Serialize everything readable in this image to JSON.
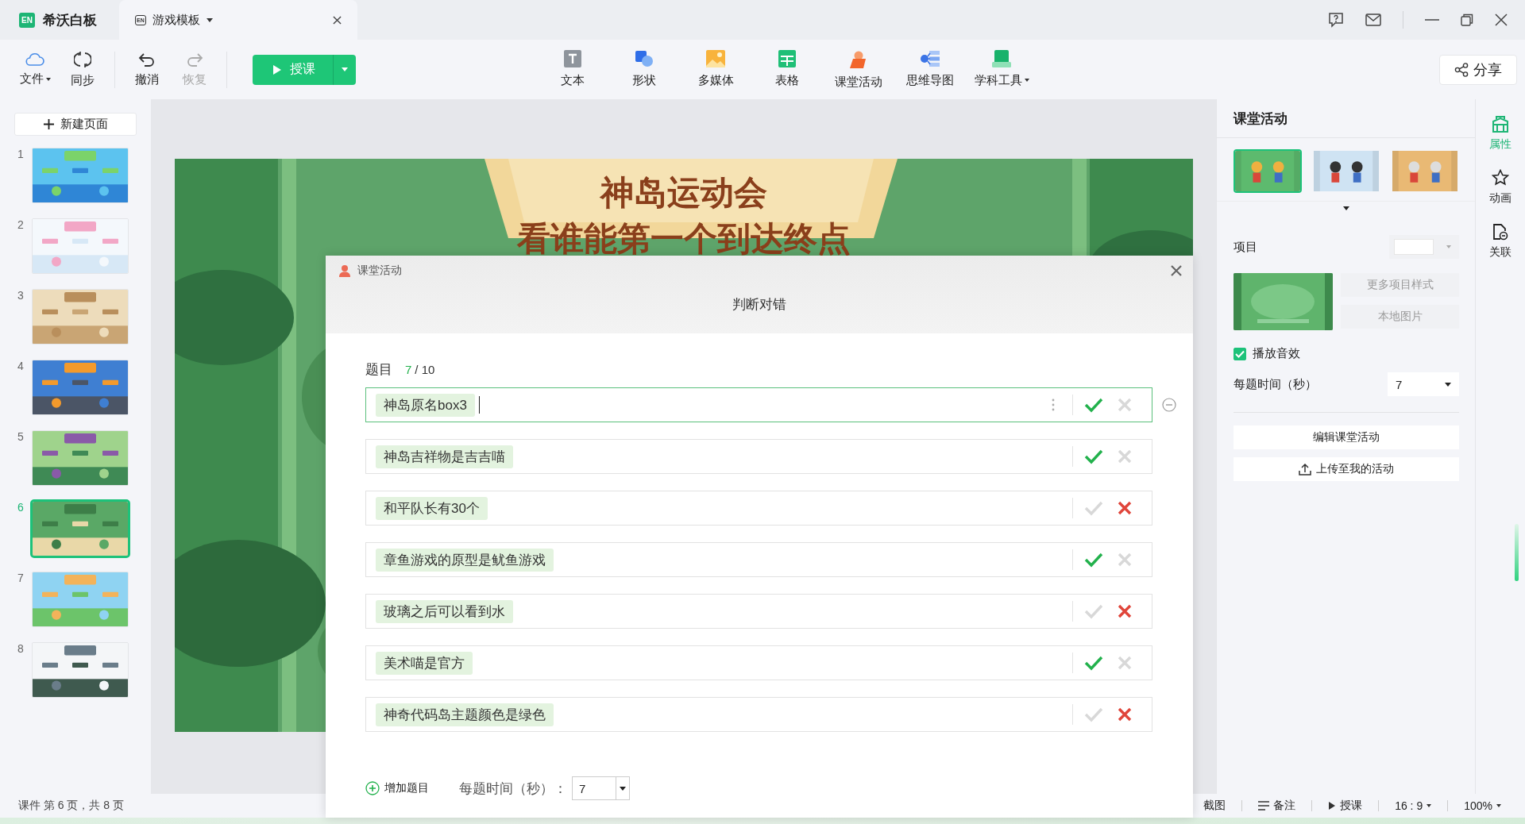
{
  "app": {
    "logo_mark": "EN",
    "name": "希沃白板"
  },
  "tab": {
    "icon_mark": "EN",
    "title": "游戏模板"
  },
  "toolbar": {
    "left": [
      {
        "label": "文件",
        "kind": "cloud",
        "menu": true,
        "disabled": false
      },
      {
        "label": "同步",
        "kind": "sync",
        "menu": false,
        "disabled": false
      },
      {
        "label": "撤消",
        "kind": "undo",
        "menu": false,
        "disabled": false
      },
      {
        "label": "恢复",
        "kind": "redo",
        "menu": false,
        "disabled": true
      }
    ],
    "teach_button": "授课",
    "tools": [
      {
        "label": "文本",
        "kind": "text",
        "menu": false
      },
      {
        "label": "形状",
        "kind": "shape",
        "menu": false
      },
      {
        "label": "多媒体",
        "kind": "media",
        "menu": false
      },
      {
        "label": "表格",
        "kind": "table",
        "menu": false
      },
      {
        "label": "课堂活动",
        "kind": "activity",
        "menu": false
      },
      {
        "label": "思维导图",
        "kind": "mindmap",
        "menu": false
      },
      {
        "label": "学科工具",
        "kind": "subject",
        "menu": true
      }
    ],
    "share_button": "分享"
  },
  "sidebar": {
    "new_page": "新建页面",
    "slides": [
      {
        "number": "1",
        "selected": false
      },
      {
        "number": "2",
        "selected": false
      },
      {
        "number": "3",
        "selected": false
      },
      {
        "number": "4",
        "selected": false
      },
      {
        "number": "5",
        "selected": false
      },
      {
        "number": "6",
        "selected": true
      },
      {
        "number": "7",
        "selected": false
      },
      {
        "number": "8",
        "selected": false
      }
    ]
  },
  "slide": {
    "title_lines": [
      "神岛运动会",
      "看谁能第一个到达终点"
    ]
  },
  "dialog": {
    "header": "课堂活动",
    "title": "判断对错",
    "question_label": "题目",
    "count": "7",
    "total": "/ 10",
    "questions": [
      {
        "text": "神岛原名box3",
        "answer": true,
        "editing": true
      },
      {
        "text": "神岛吉祥物是吉吉喵",
        "answer": true,
        "editing": false
      },
      {
        "text": "和平队长有30个",
        "answer": false,
        "editing": false
      },
      {
        "text": "章鱼游戏的原型是鱿鱼游戏",
        "answer": true,
        "editing": false
      },
      {
        "text": "玻璃之后可以看到水",
        "answer": false,
        "editing": false
      },
      {
        "text": "美术喵是官方",
        "answer": true,
        "editing": false
      },
      {
        "text": "神奇代码岛主题颜色是绿色",
        "answer": false,
        "editing": false
      }
    ],
    "add_button": "增加题目",
    "time_label": "每题时间（秒）：",
    "time_value": "7"
  },
  "panel": {
    "title": "课堂活动",
    "templates": [
      {
        "selected": true
      },
      {
        "selected": false
      },
      {
        "selected": false
      }
    ],
    "item_label": "项目",
    "more_styles_button": "更多项目样式",
    "local_image_button": "本地图片",
    "sound": {
      "label": "播放音效",
      "checked": true
    },
    "time_label": "每题时间（秒）",
    "time_value": "7",
    "edit_button": "编辑课堂活动",
    "upload_button": "上传至我的活动"
  },
  "rail": [
    {
      "label": "属性",
      "kind": "props",
      "selected": true
    },
    {
      "label": "动画",
      "kind": "anim",
      "selected": false
    },
    {
      "label": "关联",
      "kind": "link",
      "selected": false
    }
  ],
  "status_bar": {
    "page_info": "课件 第 6 页，共 8 页",
    "items": [
      {
        "label": "截图",
        "kind": "capture"
      },
      {
        "label": "备注",
        "kind": "notes"
      },
      {
        "label": "授课",
        "kind": "teach"
      },
      {
        "label": "16 : 9",
        "kind": "ratio"
      },
      {
        "label": "100%",
        "kind": "zoom"
      }
    ]
  }
}
